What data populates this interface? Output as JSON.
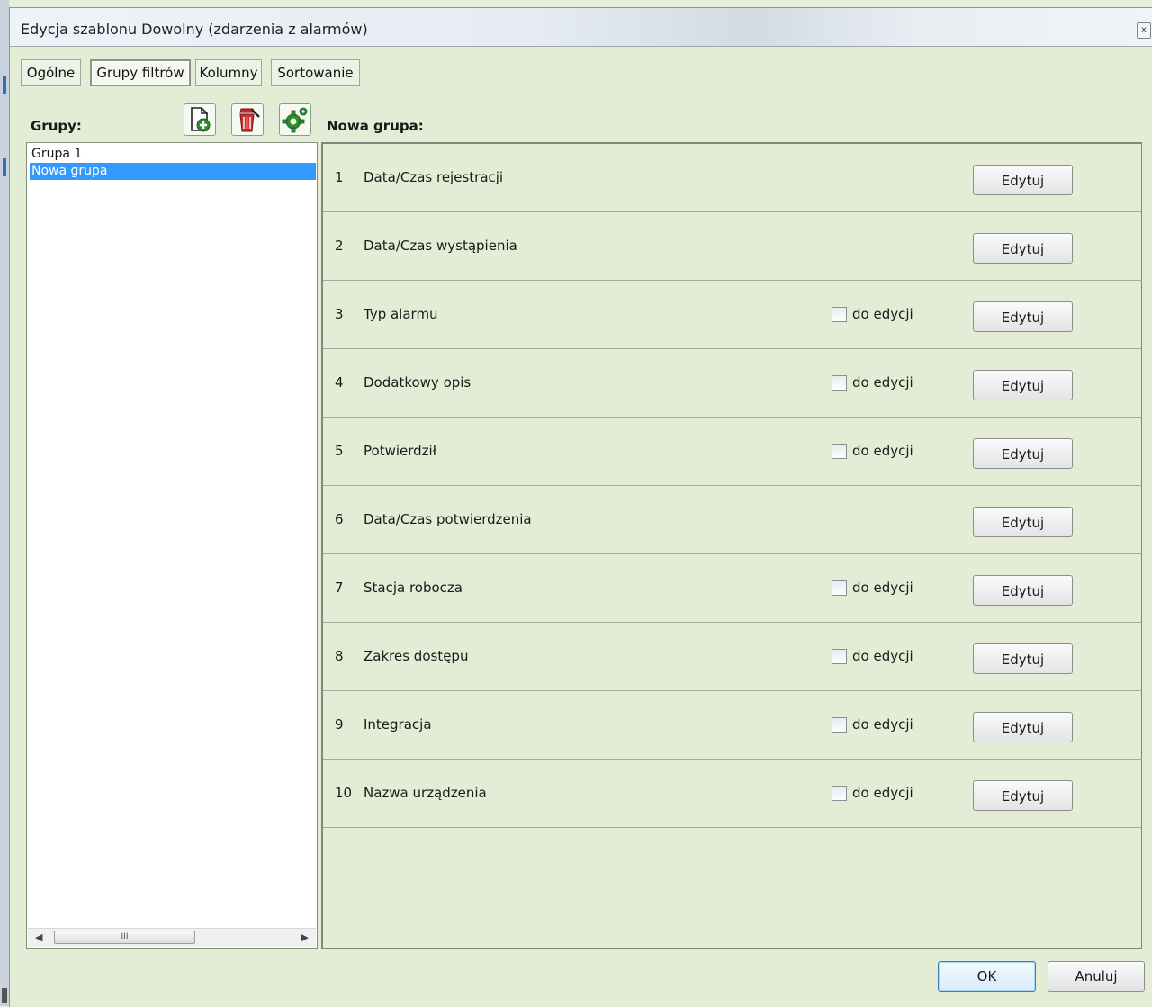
{
  "window": {
    "title": "Edycja szablonu Dowolny (zdarzenia z alarmów)",
    "close_glyph": "x"
  },
  "tabs": [
    {
      "label": "Ogólne",
      "active": false
    },
    {
      "label": "Grupy filtrów",
      "active": true
    },
    {
      "label": "Kolumny",
      "active": false
    },
    {
      "label": "Sortowanie",
      "active": false
    }
  ],
  "groups": {
    "label": "Grupy:",
    "items": [
      {
        "label": "Grupa 1",
        "selected": false
      },
      {
        "label": "Nowa grupa",
        "selected": true
      }
    ],
    "toolbar": {
      "icons": [
        "add-document-icon",
        "delete-bin-icon",
        "settings-gear-icon"
      ]
    },
    "scroll_thumb": "III"
  },
  "group_panel": {
    "title": "Nowa grupa:",
    "checkbox_label": "do edycji",
    "edit_label": "Edytuj",
    "rows": [
      {
        "num": "1",
        "name": "Data/Czas rejestracji",
        "has_checkbox": false
      },
      {
        "num": "2",
        "name": "Data/Czas wystąpienia",
        "has_checkbox": false
      },
      {
        "num": "3",
        "name": "Typ alarmu",
        "has_checkbox": true
      },
      {
        "num": "4",
        "name": "Dodatkowy opis",
        "has_checkbox": true
      },
      {
        "num": "5",
        "name": "Potwierdził",
        "has_checkbox": true
      },
      {
        "num": "6",
        "name": "Data/Czas potwierdzenia",
        "has_checkbox": false
      },
      {
        "num": "7",
        "name": "Stacja robocza",
        "has_checkbox": true
      },
      {
        "num": "8",
        "name": "Zakres dostępu",
        "has_checkbox": true
      },
      {
        "num": "9",
        "name": "Integracja",
        "has_checkbox": true
      },
      {
        "num": "10",
        "name": "Nazwa urządzenia",
        "has_checkbox": true
      }
    ]
  },
  "footer": {
    "ok_label": "OK",
    "cancel_label": "Anuluj"
  },
  "colors": {
    "background": "#e3edd5",
    "selection": "#3399ff",
    "icon_green": "#2e8b2e",
    "icon_red": "#c62828"
  }
}
